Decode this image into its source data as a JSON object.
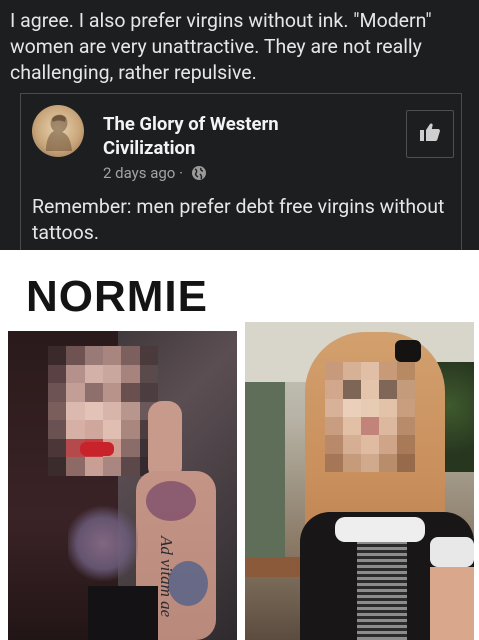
{
  "comment": {
    "text": "I agree. I also prefer virgins without ink. \"Modern\" women are very unattractive. They are not really challenging, rather repulsive."
  },
  "quoted_post": {
    "page_name": "The Glory of Western Civilization",
    "time": "2 days ago",
    "separator": "·",
    "text": "Remember: men prefer debt free virgins without tattoos.",
    "avatar_icon": "classical-bust-avatar-icon",
    "like_icon": "thumbs-up-icon",
    "privacy_icon": "globe-icon"
  },
  "meme": {
    "title": "NORMIE",
    "left_photo_caption": "",
    "tattoo_script": "Ad vitam ae"
  },
  "colors": {
    "background": "#1d1e20",
    "text": "#e6e6e6",
    "meta": "#a3a3a3",
    "border": "#4a4b4d"
  }
}
